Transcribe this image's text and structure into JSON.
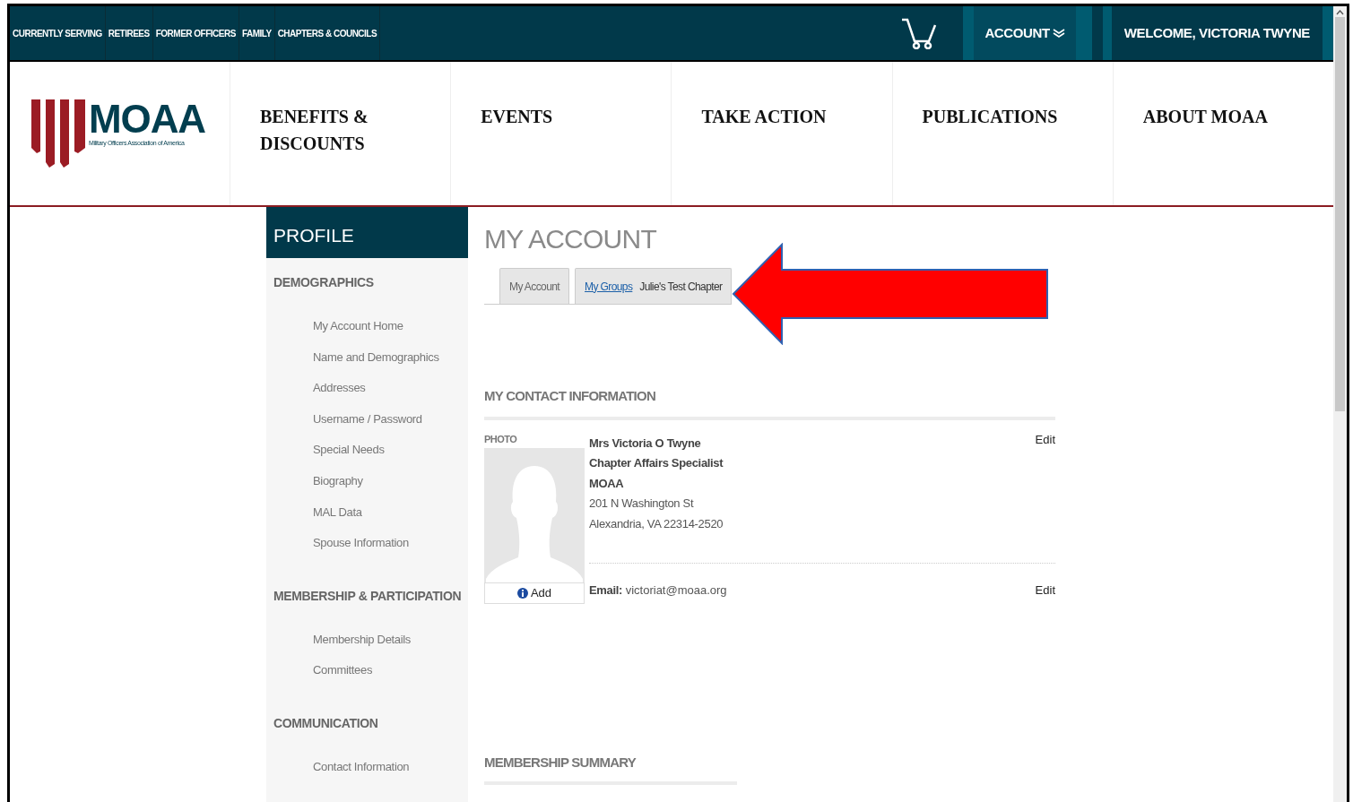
{
  "top_bar": {
    "links": [
      "CURRENTLY SERVING",
      "RETIREES",
      "FORMER OFFICERS",
      "FAMILY",
      "CHAPTERS & COUNCILS"
    ],
    "account": "ACCOUNT",
    "welcome": "WELCOME, VICTORIA TWYNE"
  },
  "logo": {
    "name": "MOAA",
    "tagline": "Military Officers Association of America"
  },
  "main_nav": [
    "BENEFITS & DISCOUNTS",
    "EVENTS",
    "TAKE ACTION",
    "PUBLICATIONS",
    "ABOUT MOAA"
  ],
  "sidebar": {
    "title": "PROFILE",
    "sections": [
      {
        "heading": "DEMOGRAPHICS",
        "items": [
          "My Account Home",
          "Name and Demographics",
          "Addresses",
          "Username / Password",
          "Special Needs",
          "Biography",
          "MAL Data",
          "Spouse Information"
        ]
      },
      {
        "heading": "MEMBERSHIP & PARTICIPATION",
        "items": [
          "Membership Details",
          "Committees"
        ]
      },
      {
        "heading": "COMMUNICATION",
        "items": [
          "Contact Information"
        ]
      }
    ]
  },
  "page_title": "MY ACCOUNT",
  "tabs": [
    {
      "label": "My Account",
      "selected": false
    },
    {
      "label": "My Groups",
      "note": "Julie's Test Chapter",
      "selected": false
    }
  ],
  "contact": {
    "heading": "MY CONTACT INFORMATION",
    "photo_label": "PHOTO",
    "add_button": "Add",
    "lines": [
      {
        "text": "Mrs Victoria O Twyne",
        "bold": true
      },
      {
        "text": "Chapter Affairs Specialist",
        "bold": true
      },
      {
        "text": "MOAA",
        "bold": true
      },
      {
        "text": "201 N Washington St",
        "bold": false
      },
      {
        "text": "Alexandria, VA  22314-2520",
        "bold": false
      }
    ],
    "edit": "Edit",
    "email_label": "Email:",
    "email": "victoriat@moaa.org",
    "email_edit": "Edit"
  },
  "membership_summary": {
    "heading": "MEMBERSHIP SUMMARY"
  }
}
